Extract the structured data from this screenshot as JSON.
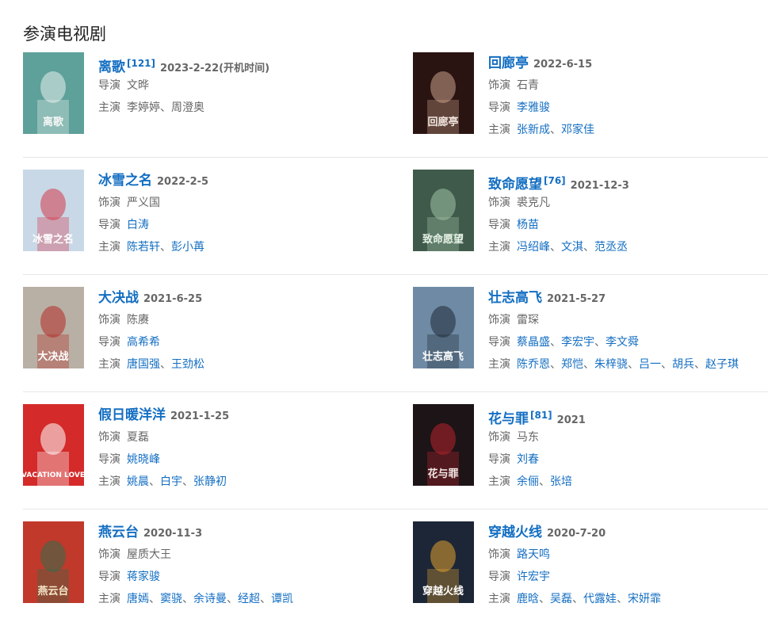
{
  "section_title": "参演电视剧",
  "shows": [
    {
      "title": "离歌",
      "ref": "[121]",
      "date": "2023-2-22(开机时间)",
      "poster": {
        "bg": "#5ea09a",
        "accent": "#e8f1ee",
        "text": "离歌",
        "text_color": "#f4f7f5"
      },
      "meta": [
        {
          "label": "导演",
          "linked": false,
          "names": [
            "文晔"
          ]
        },
        {
          "label": "主演",
          "linked": false,
          "names": [
            "李婷婷",
            "周澄奥"
          ]
        }
      ]
    },
    {
      "title": "回廊亭",
      "ref": "",
      "date": "2022-6-15",
      "poster": {
        "bg": "#2a1412",
        "accent": "#c8a08a",
        "text": "回廊亭",
        "text_color": "#f1e6e0"
      },
      "meta": [
        {
          "label": "饰演",
          "linked": false,
          "names": [
            "石青"
          ]
        },
        {
          "label": "导演",
          "linked": true,
          "names": [
            "李雅骏"
          ]
        },
        {
          "label": "主演",
          "linked": true,
          "names": [
            "张新成",
            "邓家佳"
          ]
        }
      ]
    },
    {
      "title": "冰雪之名",
      "ref": "",
      "date": "2022-2-5",
      "poster": {
        "bg": "#c8d8e6",
        "accent": "#d43a4a",
        "text": "冰雪之名",
        "text_color": "#ffffff"
      },
      "meta": [
        {
          "label": "饰演",
          "linked": false,
          "names": [
            "严义国"
          ]
        },
        {
          "label": "导演",
          "linked": true,
          "names": [
            "白涛"
          ]
        },
        {
          "label": "主演",
          "linked": true,
          "names": [
            "陈若轩",
            "彭小苒"
          ]
        }
      ]
    },
    {
      "title": "致命愿望",
      "ref": "[76]",
      "date": "2021-12-3",
      "poster": {
        "bg": "#3f5a4a",
        "accent": "#9ec2a6",
        "text": "致命愿望",
        "text_color": "#e6f2e6"
      },
      "meta": [
        {
          "label": "饰演",
          "linked": false,
          "names": [
            "裘克凡"
          ]
        },
        {
          "label": "导演",
          "linked": true,
          "names": [
            "杨苗"
          ]
        },
        {
          "label": "主演",
          "linked": true,
          "names": [
            "冯绍峰",
            "文淇",
            "范丞丞"
          ]
        }
      ]
    },
    {
      "title": "大决战",
      "ref": "",
      "date": "2021-6-25",
      "poster": {
        "bg": "#b8b0a4",
        "accent": "#b32a24",
        "text": "大决战",
        "text_color": "#ffffff"
      },
      "meta": [
        {
          "label": "饰演",
          "linked": false,
          "names": [
            "陈赓"
          ]
        },
        {
          "label": "导演",
          "linked": true,
          "names": [
            "高希希"
          ]
        },
        {
          "label": "主演",
          "linked": true,
          "names": [
            "唐国强",
            "王劲松"
          ]
        }
      ]
    },
    {
      "title": "壮志高飞",
      "ref": "",
      "date": "2021-5-27",
      "poster": {
        "bg": "#6f8aa4",
        "accent": "#1e2a36",
        "text": "壮志高飞",
        "text_color": "#ffffff"
      },
      "meta": [
        {
          "label": "饰演",
          "linked": false,
          "names": [
            "雷琛"
          ]
        },
        {
          "label": "导演",
          "linked": true,
          "names": [
            "蔡晶盛",
            "李宏宇",
            "李文舜"
          ]
        },
        {
          "label": "主演",
          "linked": true,
          "names": [
            "陈乔恩",
            "郑恺",
            "朱梓骁",
            "吕一",
            "胡兵",
            "赵子琪"
          ]
        }
      ]
    },
    {
      "title": "假日暖洋洋",
      "ref": "",
      "date": "2021-1-25",
      "poster": {
        "bg": "#d42a2a",
        "accent": "#ffffff",
        "text": "VACATION LOVE",
        "text_color": "#ffffff"
      },
      "meta": [
        {
          "label": "饰演",
          "linked": false,
          "names": [
            "夏磊"
          ]
        },
        {
          "label": "导演",
          "linked": true,
          "names": [
            "姚晓峰"
          ]
        },
        {
          "label": "主演",
          "linked": true,
          "names": [
            "姚晨",
            "白宇",
            "张静初"
          ]
        }
      ]
    },
    {
      "title": "花与罪",
      "ref": "[81]",
      "date": "2021",
      "poster": {
        "bg": "#1c1416",
        "accent": "#b8222e",
        "text": "花与罪",
        "text_color": "#f2e8e8"
      },
      "meta": [
        {
          "label": "饰演",
          "linked": false,
          "names": [
            "马东"
          ]
        },
        {
          "label": "导演",
          "linked": true,
          "names": [
            "刘春"
          ]
        },
        {
          "label": "主演",
          "linked": true,
          "names": [
            "余俪",
            "张培"
          ]
        }
      ]
    },
    {
      "title": "燕云台",
      "ref": "",
      "date": "2020-11-3",
      "poster": {
        "bg": "#c0392b",
        "accent": "#2f6e4a",
        "text": "燕云台",
        "text_color": "#f5e6c8"
      },
      "meta": [
        {
          "label": "饰演",
          "linked": false,
          "names": [
            "屋质大王"
          ]
        },
        {
          "label": "导演",
          "linked": true,
          "names": [
            "蒋家骏"
          ]
        },
        {
          "label": "主演",
          "linked": true,
          "names": [
            "唐嫣",
            "窦骁",
            "余诗曼",
            "经超",
            "谭凯"
          ]
        }
      ]
    },
    {
      "title": "穿越火线",
      "ref": "",
      "date": "2020-7-20",
      "poster": {
        "bg": "#1d2636",
        "accent": "#e0a030",
        "text": "穿越火线",
        "text_color": "#ffffff"
      },
      "meta": [
        {
          "label": "饰演",
          "linked": true,
          "names": [
            "路天鸣"
          ]
        },
        {
          "label": "导演",
          "linked": true,
          "names": [
            "许宏宇"
          ]
        },
        {
          "label": "主演",
          "linked": true,
          "names": [
            "鹿晗",
            "吴磊",
            "代露娃",
            "宋妍霏"
          ]
        }
      ]
    }
  ]
}
